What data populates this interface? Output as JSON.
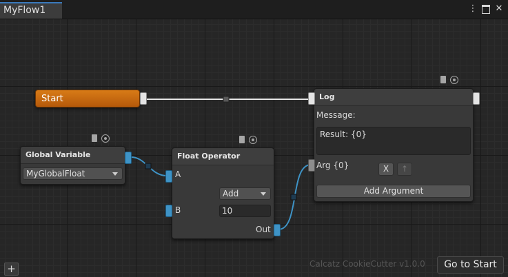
{
  "window": {
    "tab_title": "MyFlow1",
    "icons": [
      "more-icon",
      "maximize-icon",
      "close-icon"
    ]
  },
  "nodes": {
    "start": {
      "title": "Start",
      "color": "#c96a10"
    },
    "global_variable": {
      "title": "Global Variable",
      "selected": "MyGlobalFloat"
    },
    "float_operator": {
      "title": "Float Operator",
      "port_a": "A",
      "port_b": "B",
      "operation": "Add",
      "value": "10",
      "port_out": "Out"
    },
    "log": {
      "title": "Log",
      "message_label": "Message:",
      "message_value": "Result: {0}",
      "arg_label": "Arg {0}",
      "remove_label": "X",
      "up_label": "↑",
      "add_argument_label": "Add Argument"
    }
  },
  "footer": {
    "version_label": "Calcatz CookieCutter v1.0.0",
    "go_to_start_label": "Go to Start",
    "add_label": "+"
  },
  "colors": {
    "port_float": "#3e93c6",
    "port_flow": "#e4e4e4",
    "start_node": "#c96a10",
    "tab_accent": "#3a79bb"
  }
}
